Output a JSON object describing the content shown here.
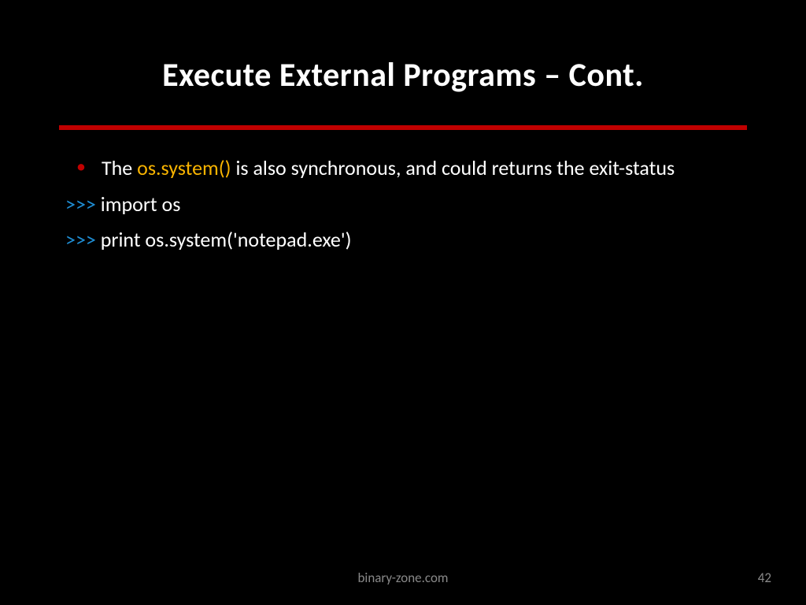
{
  "title": "Execute External Programs – Cont.",
  "bullet": {
    "pre": "The ",
    "highlight": "os.system()",
    "post": " is also synchronous, and could returns the exit-status"
  },
  "code": {
    "prompt": ">>>",
    "line1": " import os",
    "line2": " print os.system('notepad.exe')"
  },
  "footer": {
    "site": "binary-zone.com",
    "page": "42"
  },
  "colors": {
    "background": "#000000",
    "accent": "#c00000",
    "highlight": "#f9b400",
    "prompt": "#1f8fd6",
    "muted": "#888888"
  }
}
